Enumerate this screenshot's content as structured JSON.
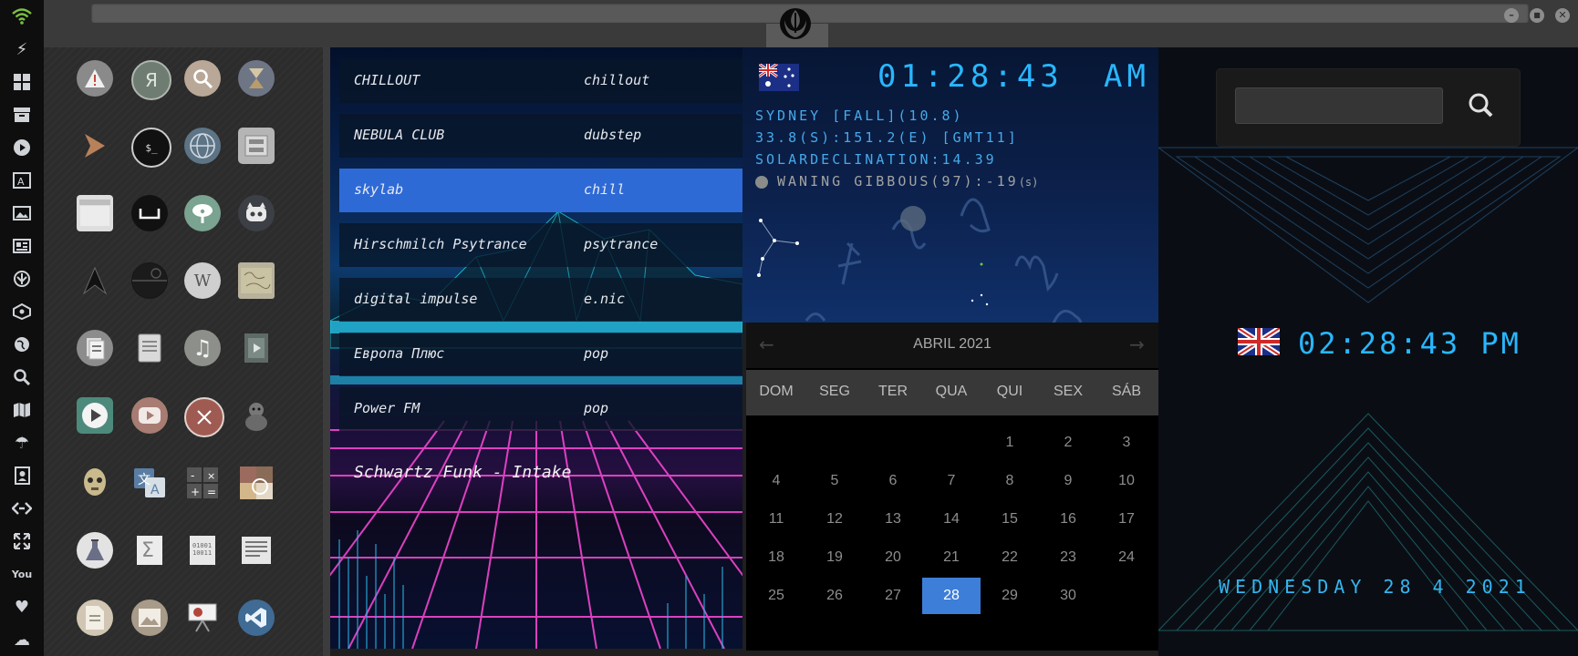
{
  "topbar": {
    "window_controls": {
      "minimize": "–",
      "maximize": "■",
      "close": "✕"
    },
    "tab_icon": "rebel-alliance-icon"
  },
  "leftbar": {
    "icons": [
      "wifi-icon",
      "lightning-icon",
      "windows-icon",
      "archive-icon",
      "play-icon",
      "translate-icon",
      "image-icon",
      "news-icon",
      "rebel-icon",
      "network-icon",
      "globe-icon",
      "search-icon",
      "map-icon",
      "umbrella-icon",
      "contacts-icon",
      "code-icon",
      "expand-icon",
      "youtube-icon",
      "heart-icon",
      "cloud-icon"
    ]
  },
  "apps": [
    [
      "warning-icon",
      "yandex-icon",
      "search-icon",
      "hourglass-icon"
    ],
    [
      "terminal-arrow-icon",
      "shell-icon",
      "globe-icon",
      "disk-icon"
    ],
    [
      "window-icon",
      "sleep-icon",
      "cloud-key-icon",
      "robot-icon"
    ],
    [
      "starfleet-icon",
      "death-star-icon",
      "wikipedia-icon",
      "map-icon"
    ],
    [
      "documents-icon",
      "notes-icon",
      "music-icon",
      "video-icon"
    ],
    [
      "player-icon",
      "youtube-icon",
      "close-circle-icon",
      "monkey-icon"
    ],
    [
      "c3po-icon",
      "translate-icon",
      "calculator-icon",
      "photo-icon"
    ],
    [
      "flask-icon",
      "sigma-icon",
      "binary-icon",
      "text-icon"
    ],
    [
      "file-icon",
      "image-icon",
      "presentation-icon",
      "vscode-icon"
    ]
  ],
  "radio": {
    "stations": [
      {
        "name": "CHILLOUT",
        "genre": "chillout"
      },
      {
        "name": "NEBULA CLUB",
        "genre": "dubstep"
      },
      {
        "name": "skylab",
        "genre": "chill"
      },
      {
        "name": "Hirschmilch Psytrance",
        "genre": "psytrance"
      },
      {
        "name": "digital impulse",
        "genre": "e.nic"
      },
      {
        "name": "Европа Плюс",
        "genre": "pop"
      },
      {
        "name": "Power FM",
        "genre": "pop"
      }
    ],
    "now_playing": "Schwartz Funk - Intake"
  },
  "astro": {
    "time": "01:28:43",
    "ampm": "AM",
    "line1": "SYDNEY [FALL](10.8)",
    "line2": "33.8(S):151.2(E) [GMT11]",
    "line3": "SOLARDECLINATION:14.39",
    "moon": "WANING GIBBOUS(97):-19",
    "moon_unit": "(s)"
  },
  "calendar": {
    "month": "ABRIL 2021",
    "prev": "←",
    "next": "→",
    "days": [
      "DOM",
      "SEG",
      "TER",
      "QUA",
      "QUI",
      "SEX",
      "SÁB"
    ],
    "weeks": [
      [
        "",
        "",
        "",
        "",
        "1",
        "2",
        "3"
      ],
      [
        "4",
        "5",
        "6",
        "7",
        "8",
        "9",
        "10"
      ],
      [
        "11",
        "12",
        "13",
        "14",
        "15",
        "16",
        "17"
      ],
      [
        "18",
        "19",
        "20",
        "21",
        "22",
        "23",
        "24"
      ],
      [
        "25",
        "26",
        "27",
        "28",
        "29",
        "30",
        ""
      ]
    ],
    "today": "28"
  },
  "world": {
    "search_value": "",
    "time": "02:28:43 PM",
    "date": "WEDNESDAY 28 4 2021"
  },
  "colors": {
    "accent": "#3d7ed8",
    "digital": "#28b7ff",
    "selected_station": "#2e6ad6"
  }
}
